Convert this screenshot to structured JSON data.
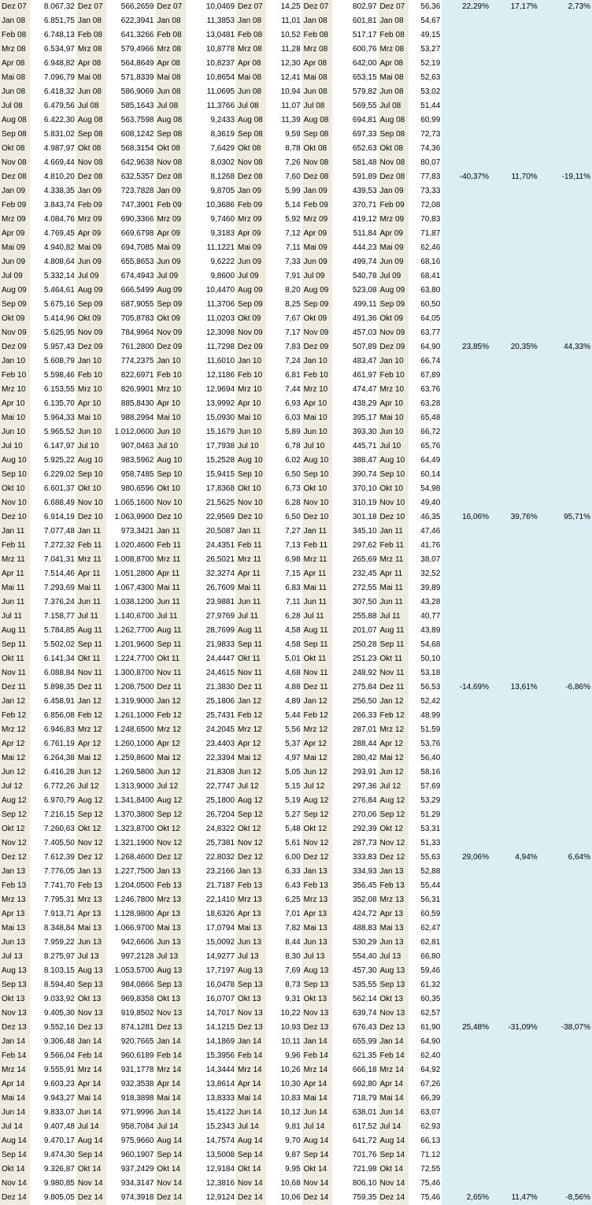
{
  "rows": [
    {
      "d": "Dez 07",
      "v": [
        "8.067,32",
        "566,2659",
        "10,0469",
        "14,25",
        "802,97",
        "56,36"
      ],
      "p": [
        "22,29%",
        "17,17%",
        "2,73%"
      ]
    },
    {
      "d": "Jan 08",
      "v": [
        "6.851,75",
        "622,3941",
        "11,3853",
        "11,01",
        "601,81",
        "54,67"
      ],
      "p": [
        "",
        "",
        ""
      ]
    },
    {
      "d": "Feb 08",
      "v": [
        "6.748,13",
        "641,3266",
        "13,0481",
        "10,52",
        "517,17",
        "49,15"
      ],
      "p": [
        "",
        "",
        ""
      ]
    },
    {
      "d": "Mrz 08",
      "v": [
        "6.534,97",
        "579,4966",
        "10,8778",
        "11,28",
        "600,76",
        "53,27"
      ],
      "p": [
        "",
        "",
        ""
      ]
    },
    {
      "d": "Apr 08",
      "v": [
        "6.948,82",
        "564,8649",
        "10,8237",
        "12,30",
        "642,00",
        "52,19"
      ],
      "p": [
        "",
        "",
        ""
      ]
    },
    {
      "d": "Mai 08",
      "v": [
        "7.096,79",
        "571,8339",
        "10,8654",
        "12,41",
        "653,15",
        "52,63"
      ],
      "p": [
        "",
        "",
        ""
      ]
    },
    {
      "d": "Jun 08",
      "v": [
        "6.418,32",
        "586,9069",
        "11,0695",
        "10,94",
        "579,82",
        "53,02"
      ],
      "p": [
        "",
        "",
        ""
      ]
    },
    {
      "d": "Jul 08",
      "v": [
        "6.479,56",
        "585,1643",
        "11,3766",
        "11,07",
        "569,55",
        "51,44"
      ],
      "p": [
        "",
        "",
        ""
      ]
    },
    {
      "d": "Aug 08",
      "v": [
        "6.422,30",
        "563,7598",
        "9,2433",
        "11,39",
        "694,81",
        "60,99"
      ],
      "p": [
        "",
        "",
        ""
      ]
    },
    {
      "d": "Sep 08",
      "v": [
        "5.831,02",
        "608,1242",
        "8,3619",
        "9,59",
        "697,33",
        "72,73"
      ],
      "p": [
        "",
        "",
        ""
      ]
    },
    {
      "d": "Okt 08",
      "v": [
        "4.987,97",
        "568,3154",
        "7,6429",
        "8,78",
        "652,63",
        "74,36"
      ],
      "p": [
        "",
        "",
        ""
      ]
    },
    {
      "d": "Nov 08",
      "v": [
        "4.669,44",
        "642,9638",
        "8,0302",
        "7,26",
        "581,48",
        "80,07"
      ],
      "p": [
        "",
        "",
        ""
      ]
    },
    {
      "d": "Dez 08",
      "v": [
        "4.810,20",
        "632,5357",
        "8,1268",
        "7,60",
        "591,89",
        "77,83"
      ],
      "p": [
        "-40,37%",
        "11,70%",
        "-19,11%"
      ]
    },
    {
      "d": "Jan 09",
      "v": [
        "4.338,35",
        "723,7828",
        "9,8705",
        "5,99",
        "439,53",
        "73,33"
      ],
      "p": [
        "",
        "",
        ""
      ]
    },
    {
      "d": "Feb 09",
      "v": [
        "3.843,74",
        "747,3901",
        "10,3686",
        "5,14",
        "370,71",
        "72,08"
      ],
      "p": [
        "",
        "",
        ""
      ]
    },
    {
      "d": "Mrz 09",
      "v": [
        "4.084,76",
        "690,3366",
        "9,7460",
        "5,92",
        "419,12",
        "70,83"
      ],
      "p": [
        "",
        "",
        ""
      ]
    },
    {
      "d": "Apr 09",
      "v": [
        "4.769,45",
        "669,6798",
        "9,3183",
        "7,12",
        "511,84",
        "71,87"
      ],
      "p": [
        "",
        "",
        ""
      ]
    },
    {
      "d": "Mai 09",
      "v": [
        "4.940,82",
        "694,7085",
        "11,1221",
        "7,11",
        "444,23",
        "62,46"
      ],
      "p": [
        "",
        "",
        ""
      ]
    },
    {
      "d": "Jun 09",
      "v": [
        "4.808,64",
        "655,8653",
        "9,6222",
        "7,33",
        "499,74",
        "68,16"
      ],
      "p": [
        "",
        "",
        ""
      ]
    },
    {
      "d": "Jul 09",
      "v": [
        "5.332,14",
        "674,4943",
        "9,8600",
        "7,91",
        "540,78",
        "68,41"
      ],
      "p": [
        "",
        "",
        ""
      ]
    },
    {
      "d": "Aug 09",
      "v": [
        "5.464,61",
        "666,5499",
        "10,4470",
        "8,20",
        "523,08",
        "63,80"
      ],
      "p": [
        "",
        "",
        ""
      ]
    },
    {
      "d": "Sep 09",
      "v": [
        "5.675,16",
        "687,9055",
        "11,3706",
        "8,25",
        "499,11",
        "60,50"
      ],
      "p": [
        "",
        "",
        ""
      ]
    },
    {
      "d": "Okt 09",
      "v": [
        "5.414,96",
        "705,8783",
        "11,0203",
        "7,67",
        "491,36",
        "64,05"
      ],
      "p": [
        "",
        "",
        ""
      ]
    },
    {
      "d": "Nov 09",
      "v": [
        "5.625,95",
        "784,9964",
        "12,3098",
        "7,17",
        "457,03",
        "63,77"
      ],
      "p": [
        "",
        "",
        ""
      ]
    },
    {
      "d": "Dez 09",
      "v": [
        "5.957,43",
        "761,2800",
        "11,7298",
        "7,83",
        "507,89",
        "64,90"
      ],
      "p": [
        "23,85%",
        "20,35%",
        "44,33%"
      ]
    },
    {
      "d": "Jan 10",
      "v": [
        "5.608,79",
        "774,2375",
        "11,6010",
        "7,24",
        "483,47",
        "66,74"
      ],
      "p": [
        "",
        "",
        ""
      ]
    },
    {
      "d": "Feb 10",
      "v": [
        "5.598,46",
        "822,6971",
        "12,1186",
        "6,81",
        "461,97",
        "67,89"
      ],
      "p": [
        "",
        "",
        ""
      ]
    },
    {
      "d": "Mrz 10",
      "v": [
        "6.153,55",
        "826,9901",
        "12,9694",
        "7,44",
        "474,47",
        "63,76"
      ],
      "p": [
        "",
        "",
        ""
      ]
    },
    {
      "d": "Apr 10",
      "v": [
        "6.135,70",
        "885,8430",
        "13,9992",
        "6,93",
        "438,29",
        "63,28"
      ],
      "p": [
        "",
        "",
        ""
      ]
    },
    {
      "d": "Mai 10",
      "v": [
        "5.964,33",
        "988,2994",
        "15,0930",
        "6,03",
        "395,17",
        "65,48"
      ],
      "p": [
        "",
        "",
        ""
      ]
    },
    {
      "d": "Jun 10",
      "v": [
        "5.965,52",
        "1.012,0600",
        "15,1679",
        "5,89",
        "393,30",
        "66,72"
      ],
      "p": [
        "",
        "",
        ""
      ]
    },
    {
      "d": "Jul 10",
      "v": [
        "6.147,97",
        "907,0463",
        "17,7938",
        "6,78",
        "445,71",
        "65,76"
      ],
      "p": [
        "",
        "",
        ""
      ]
    },
    {
      "d": "Aug 10",
      "v": [
        "5.925,22",
        "983,5962",
        "15,2528",
        "6,02",
        "388,47",
        "64,49"
      ],
      "p": [
        "",
        "",
        ""
      ]
    },
    {
      "d": "Sep 10",
      "v": [
        "6.229,02",
        "958,7485",
        "15,9415",
        "6,50",
        "390,74",
        "60,14"
      ],
      "p": [
        "",
        "",
        ""
      ]
    },
    {
      "d": "Okt 10",
      "v": [
        "6.601,37",
        "980,6596",
        "17,8368",
        "6,73",
        "370,10",
        "54,98"
      ],
      "p": [
        "",
        "",
        ""
      ]
    },
    {
      "d": "Nov 10",
      "v": [
        "6.688,49",
        "1.065,1600",
        "21,5625",
        "6,28",
        "310,19",
        "49,40"
      ],
      "p": [
        "",
        "",
        ""
      ]
    },
    {
      "d": "Dez 10",
      "v": [
        "6.914,19",
        "1.063,9900",
        "22,9569",
        "6,50",
        "301,18",
        "46,35"
      ],
      "p": [
        "16,06%",
        "39,76%",
        "95,71%"
      ]
    },
    {
      "d": "Jan 11",
      "v": [
        "7.077,48",
        "973,3421",
        "20,5087",
        "7,27",
        "345,10",
        "47,46"
      ],
      "p": [
        "",
        "",
        ""
      ]
    },
    {
      "d": "Feb 11",
      "v": [
        "7.272,32",
        "1.020,4600",
        "24,4351",
        "7,13",
        "297,62",
        "41,76"
      ],
      "p": [
        "",
        "",
        ""
      ]
    },
    {
      "d": "Mrz 11",
      "v": [
        "7.041,31",
        "1.008,8700",
        "26,5021",
        "6,98",
        "265,69",
        "38,07"
      ],
      "p": [
        "",
        "",
        ""
      ]
    },
    {
      "d": "Apr 11",
      "v": [
        "7.514,46",
        "1.051,2800",
        "32,3274",
        "7,15",
        "232,45",
        "32,52"
      ],
      "p": [
        "",
        "",
        ""
      ]
    },
    {
      "d": "Mai 11",
      "v": [
        "7.293,69",
        "1.067,4300",
        "26,7609",
        "6,83",
        "272,55",
        "39,89"
      ],
      "p": [
        "",
        "",
        ""
      ]
    },
    {
      "d": "Jun 11",
      "v": [
        "7.376,24",
        "1.038,1200",
        "23,9881",
        "7,11",
        "307,50",
        "43,28"
      ],
      "p": [
        "",
        "",
        ""
      ]
    },
    {
      "d": "Jul 11",
      "v": [
        "7.158,77",
        "1.140,6700",
        "27,9769",
        "6,28",
        "255,88",
        "40,77"
      ],
      "p": [
        "",
        "",
        ""
      ]
    },
    {
      "d": "Aug 11",
      "v": [
        "5.784,85",
        "1.262,7700",
        "28,7699",
        "4,58",
        "201,07",
        "43,89"
      ],
      "p": [
        "",
        "",
        ""
      ]
    },
    {
      "d": "Sep 11",
      "v": [
        "5.502,02",
        "1.201,9600",
        "21,9833",
        "4,58",
        "250,28",
        "54,68"
      ],
      "p": [
        "",
        "",
        ""
      ]
    },
    {
      "d": "Okt 11",
      "v": [
        "6.141,34",
        "1.224,7700",
        "24,4447",
        "5,01",
        "251,23",
        "50,10"
      ],
      "p": [
        "",
        "",
        ""
      ]
    },
    {
      "d": "Nov 11",
      "v": [
        "6.088,84",
        "1.300,8700",
        "24,4615",
        "4,68",
        "248,92",
        "53,18"
      ],
      "p": [
        "",
        "",
        ""
      ]
    },
    {
      "d": "Dez 11",
      "v": [
        "5.898,35",
        "1.208,7500",
        "21,3830",
        "4,88",
        "275,84",
        "56,53"
      ],
      "p": [
        "-14,69%",
        "13,61%",
        "-6,86%"
      ]
    },
    {
      "d": "Jan 12",
      "v": [
        "6.458,91",
        "1.319,9000",
        "25,1806",
        "4,89",
        "256,50",
        "52,42"
      ],
      "p": [
        "",
        "",
        ""
      ]
    },
    {
      "d": "Feb 12",
      "v": [
        "6.856,08",
        "1.261,1000",
        "25,7431",
        "5,44",
        "266,33",
        "48,99"
      ],
      "p": [
        "",
        "",
        ""
      ]
    },
    {
      "d": "Mrz 12",
      "v": [
        "6.946,83",
        "1.248,6500",
        "24,2045",
        "5,56",
        "287,01",
        "51,59"
      ],
      "p": [
        "",
        "",
        ""
      ]
    },
    {
      "d": "Apr 12",
      "v": [
        "6.761,19",
        "1.260,1000",
        "23,4403",
        "5,37",
        "288,44",
        "53,76"
      ],
      "p": [
        "",
        "",
        ""
      ]
    },
    {
      "d": "Mai 12",
      "v": [
        "6.264,38",
        "1.259,8600",
        "22,3394",
        "4,97",
        "280,42",
        "56,40"
      ],
      "p": [
        "",
        "",
        ""
      ]
    },
    {
      "d": "Jun 12",
      "v": [
        "6.416,28",
        "1.269,5800",
        "21,8308",
        "5,05",
        "293,91",
        "58,16"
      ],
      "p": [
        "",
        "",
        ""
      ]
    },
    {
      "d": "Jul 12",
      "v": [
        "6.772,26",
        "1.313,9000",
        "22,7747",
        "5,15",
        "297,36",
        "57,69"
      ],
      "p": [
        "",
        "",
        ""
      ]
    },
    {
      "d": "Aug 12",
      "v": [
        "6.970,79",
        "1.341,8400",
        "25,1800",
        "5,19",
        "276,84",
        "53,29"
      ],
      "p": [
        "",
        "",
        ""
      ]
    },
    {
      "d": "Sep 12",
      "v": [
        "7.216,15",
        "1.370,3800",
        "26,7204",
        "5,27",
        "270,06",
        "51,29"
      ],
      "p": [
        "",
        "",
        ""
      ]
    },
    {
      "d": "Okt 12",
      "v": [
        "7.260,63",
        "1.323,8700",
        "24,8322",
        "5,48",
        "292,39",
        "53,31"
      ],
      "p": [
        "",
        "",
        ""
      ]
    },
    {
      "d": "Nov 12",
      "v": [
        "7.405,50",
        "1.321,1900",
        "25,7381",
        "5,61",
        "287,73",
        "51,33"
      ],
      "p": [
        "",
        "",
        ""
      ]
    },
    {
      "d": "Dez 12",
      "v": [
        "7.612,39",
        "1.268,4600",
        "22,8032",
        "6,00",
        "333,83",
        "55,63"
      ],
      "p": [
        "29,06%",
        "4,94%",
        "6,64%"
      ]
    },
    {
      "d": "Jan 13",
      "v": [
        "7.776,05",
        "1.227,7500",
        "23,2166",
        "6,33",
        "334,93",
        "52,88"
      ],
      "p": [
        "",
        "",
        ""
      ]
    },
    {
      "d": "Feb 13",
      "v": [
        "7.741,70",
        "1.204,0500",
        "21,7187",
        "6,43",
        "356,45",
        "55,44"
      ],
      "p": [
        "",
        "",
        ""
      ]
    },
    {
      "d": "Mrz 13",
      "v": [
        "7.795,31",
        "1.246,7800",
        "22,1410",
        "6,25",
        "352,08",
        "56,31"
      ],
      "p": [
        "",
        "",
        ""
      ]
    },
    {
      "d": "Apr 13",
      "v": [
        "7.913,71",
        "1.128,9800",
        "18,6326",
        "7,01",
        "424,72",
        "60,59"
      ],
      "p": [
        "",
        "",
        ""
      ]
    },
    {
      "d": "Mai 13",
      "v": [
        "8.348,84",
        "1.066,9700",
        "17,0794",
        "7,82",
        "488,83",
        "62,47"
      ],
      "p": [
        "",
        "",
        ""
      ]
    },
    {
      "d": "Jun 13",
      "v": [
        "7.959,22",
        "942,6606",
        "15,0092",
        "8,44",
        "530,29",
        "62,81"
      ],
      "p": [
        "",
        "",
        ""
      ]
    },
    {
      "d": "Jul 13",
      "v": [
        "8.275,97",
        "997,2128",
        "14,9277",
        "8,30",
        "554,40",
        "66,80"
      ],
      "p": [
        "",
        "",
        ""
      ]
    },
    {
      "d": "Aug 13",
      "v": [
        "8.103,15",
        "1.053,5700",
        "17,7197",
        "7,69",
        "457,30",
        "59,46"
      ],
      "p": [
        "",
        "",
        ""
      ]
    },
    {
      "d": "Sep 13",
      "v": [
        "8.594,40",
        "984,0866",
        "16,0478",
        "8,73",
        "535,55",
        "61,32"
      ],
      "p": [
        "",
        "",
        ""
      ]
    },
    {
      "d": "Okt 13",
      "v": [
        "9.033,92",
        "969,8358",
        "16,0707",
        "9,31",
        "562,14",
        "60,35"
      ],
      "p": [
        "",
        "",
        ""
      ]
    },
    {
      "d": "Nov 13",
      "v": [
        "9.405,30",
        "919,8502",
        "14,7017",
        "10,22",
        "639,74",
        "62,57"
      ],
      "p": [
        "",
        "",
        ""
      ]
    },
    {
      "d": "Dez 13",
      "v": [
        "9.552,16",
        "874,1281",
        "14,1215",
        "10,93",
        "676,43",
        "61,90"
      ],
      "p": [
        "25,48%",
        "-31,09%",
        "-38,07%"
      ]
    },
    {
      "d": "Jan 14",
      "v": [
        "9.306,48",
        "920,7665",
        "14,1869",
        "10,11",
        "655,99",
        "64,90"
      ],
      "p": [
        "",
        "",
        ""
      ]
    },
    {
      "d": "Feb 14",
      "v": [
        "9.566,04",
        "960,6189",
        "15,3956",
        "9,96",
        "621,35",
        "62,40"
      ],
      "p": [
        "",
        "",
        ""
      ]
    },
    {
      "d": "Mrz 14",
      "v": [
        "9.555,91",
        "931,1778",
        "14,3444",
        "10,26",
        "666,18",
        "64,92"
      ],
      "p": [
        "",
        "",
        ""
      ]
    },
    {
      "d": "Apr 14",
      "v": [
        "9.603,23",
        "932,3538",
        "13,8614",
        "10,30",
        "692,80",
        "67,26"
      ],
      "p": [
        "",
        "",
        ""
      ]
    },
    {
      "d": "Mai 14",
      "v": [
        "9.943,27",
        "918,3898",
        "13,8333",
        "10,83",
        "718,79",
        "66,39"
      ],
      "p": [
        "",
        "",
        ""
      ]
    },
    {
      "d": "Jun 14",
      "v": [
        "9.833,07",
        "971,9996",
        "15,4122",
        "10,12",
        "638,01",
        "63,07"
      ],
      "p": [
        "",
        "",
        ""
      ]
    },
    {
      "d": "Jul 14",
      "v": [
        "9.407,48",
        "958,7084",
        "15,2343",
        "9,81",
        "617,52",
        "62,93"
      ],
      "p": [
        "",
        "",
        ""
      ]
    },
    {
      "d": "Aug 14",
      "v": [
        "9.470,17",
        "975,9660",
        "14,7574",
        "9,70",
        "641,72",
        "66,13"
      ],
      "p": [
        "",
        "",
        ""
      ]
    },
    {
      "d": "Sep 14",
      "v": [
        "9.474,30",
        "960,1907",
        "13,5008",
        "9,87",
        "701,76",
        "71,12"
      ],
      "p": [
        "",
        "",
        ""
      ]
    },
    {
      "d": "Okt 14",
      "v": [
        "9.326,87",
        "937,2429",
        "12,9184",
        "9,95",
        "721,98",
        "72,55"
      ],
      "p": [
        "",
        "",
        ""
      ]
    },
    {
      "d": "Nov 14",
      "v": [
        "9.980,85",
        "934,3147",
        "12,3816",
        "10,68",
        "806,10",
        "75,46"
      ],
      "p": [
        "",
        "",
        ""
      ]
    },
    {
      "d": "Dez 14",
      "v": [
        "9.805,05",
        "974,3918",
        "12,9124",
        "10,06",
        "759,35",
        "75,46"
      ],
      "p": [
        "2,65%",
        "11,47%",
        "-8,56%"
      ]
    }
  ],
  "colors": {
    "date_column_bg": "#eeece1",
    "value_column_bg": "#ffffff",
    "percent_column_bg": "#dbeef4",
    "text": "#000000"
  }
}
